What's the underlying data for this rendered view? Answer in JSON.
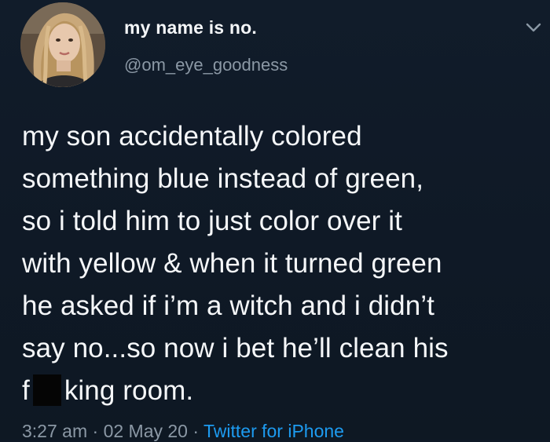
{
  "user": {
    "display_name": "my name is no.",
    "handle": "@om_eye_goodness"
  },
  "icons": {
    "menu": "chevron-down-icon",
    "avatar": "profile-photo"
  },
  "tweet": {
    "lines": [
      "my son accidentally colored",
      "something blue instead of green,",
      "so i told him to just color over it",
      "with yellow & when it turned green",
      "he asked if i’m a witch and i didn’t",
      "say no...so now i bet he’ll clean his"
    ],
    "last_line_prefix": "f",
    "last_line_suffix": "king room."
  },
  "meta": {
    "time": "3:27 am",
    "separator": " · ",
    "date": "02 May 20",
    "source": "Twitter for iPhone"
  },
  "colors": {
    "background": "#0f1926",
    "text": "#f5f7f9",
    "secondary": "#8b98a5",
    "link": "#1d9bf0"
  }
}
